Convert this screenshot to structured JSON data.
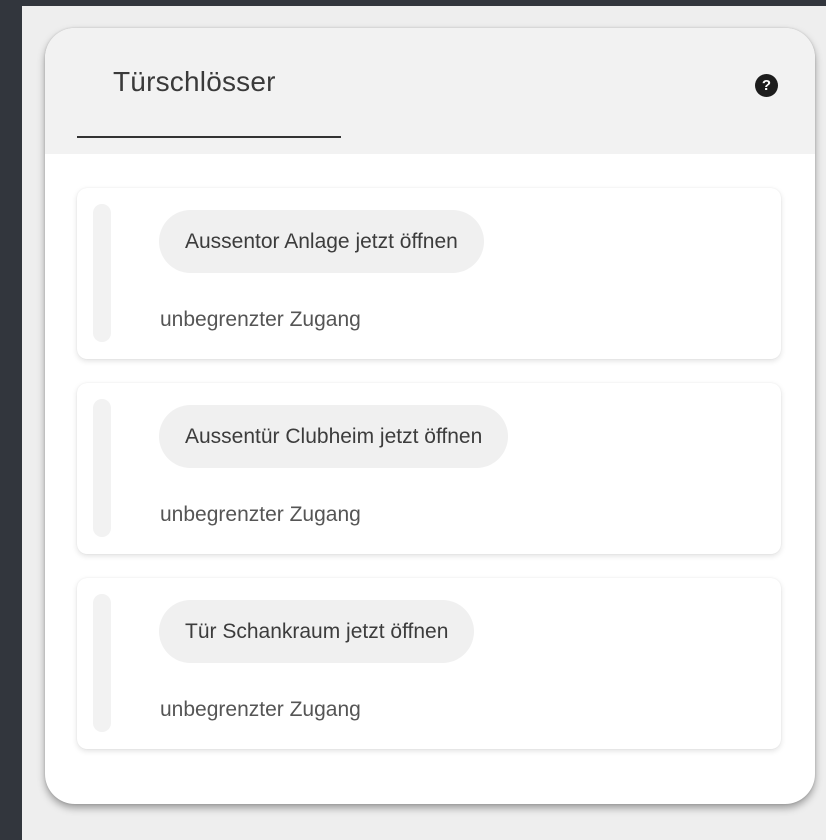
{
  "card": {
    "tab_label": "Türschlösser",
    "help_icon": "question-circle-icon",
    "help_glyph": "?"
  },
  "locks": [
    {
      "button_label": "Aussentor Anlage jetzt öffnen",
      "access": "unbegrenzter Zugang"
    },
    {
      "button_label": "Aussentür Clubheim jetzt öffnen",
      "access": "unbegrenzter Zugang"
    },
    {
      "button_label": "Tür Schankraum jetzt öffnen",
      "access": "unbegrenzter Zugang"
    }
  ],
  "colors": {
    "page_background": "#eeeeee",
    "app_frame": "#32363d",
    "card_background": "#ffffff",
    "header_background": "#f2f2f2",
    "tab_underline": "#333333",
    "button_background": "#f0f0f0"
  }
}
